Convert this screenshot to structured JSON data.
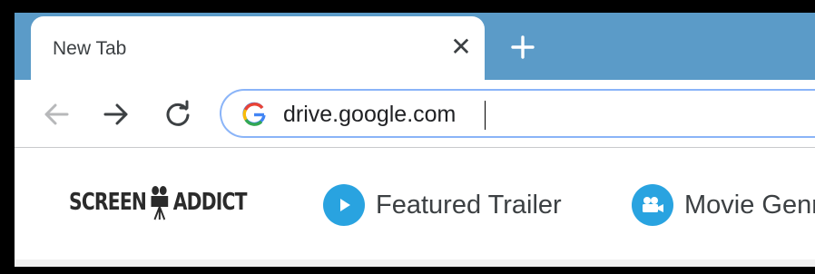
{
  "tab": {
    "title": "New Tab",
    "close_glyph": "✕"
  },
  "new_tab": {
    "icon": "plus-icon"
  },
  "nav": {
    "back_icon": "arrow-left-icon",
    "forward_icon": "arrow-right-icon",
    "reload_icon": "reload-icon"
  },
  "omnibox": {
    "value": "drive.google.com",
    "icon": "google-g-icon"
  },
  "bookmarks": {
    "logo_left": "SCREEN",
    "logo_right": "ADDICT",
    "items": [
      {
        "label": "Featured Trailer",
        "icon": "play-icon"
      },
      {
        "label": "Movie Genres",
        "icon": "movie-camera-icon"
      }
    ]
  },
  "colors": {
    "tabstrip": "#5b9bc8",
    "bookmark_icon_bg": "#29a3e0",
    "omnibox_border": "#8ab4f8"
  }
}
